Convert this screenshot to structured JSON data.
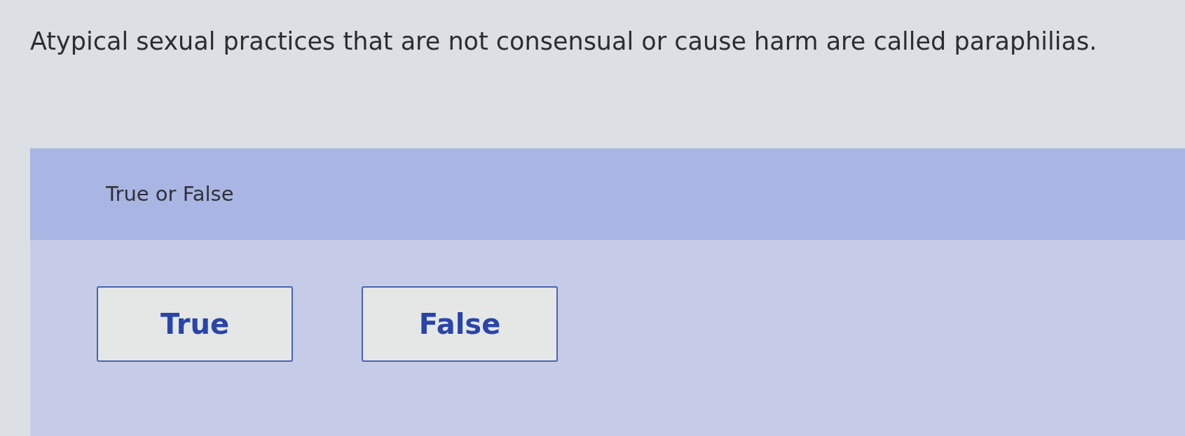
{
  "question": {
    "text": "Atypical sexual practices that are not consensual or cause harm are called paraphilias."
  },
  "prompt": {
    "label": "True or False"
  },
  "options": [
    {
      "label": "True",
      "selected": false
    },
    {
      "label": "False",
      "selected": false
    }
  ]
}
